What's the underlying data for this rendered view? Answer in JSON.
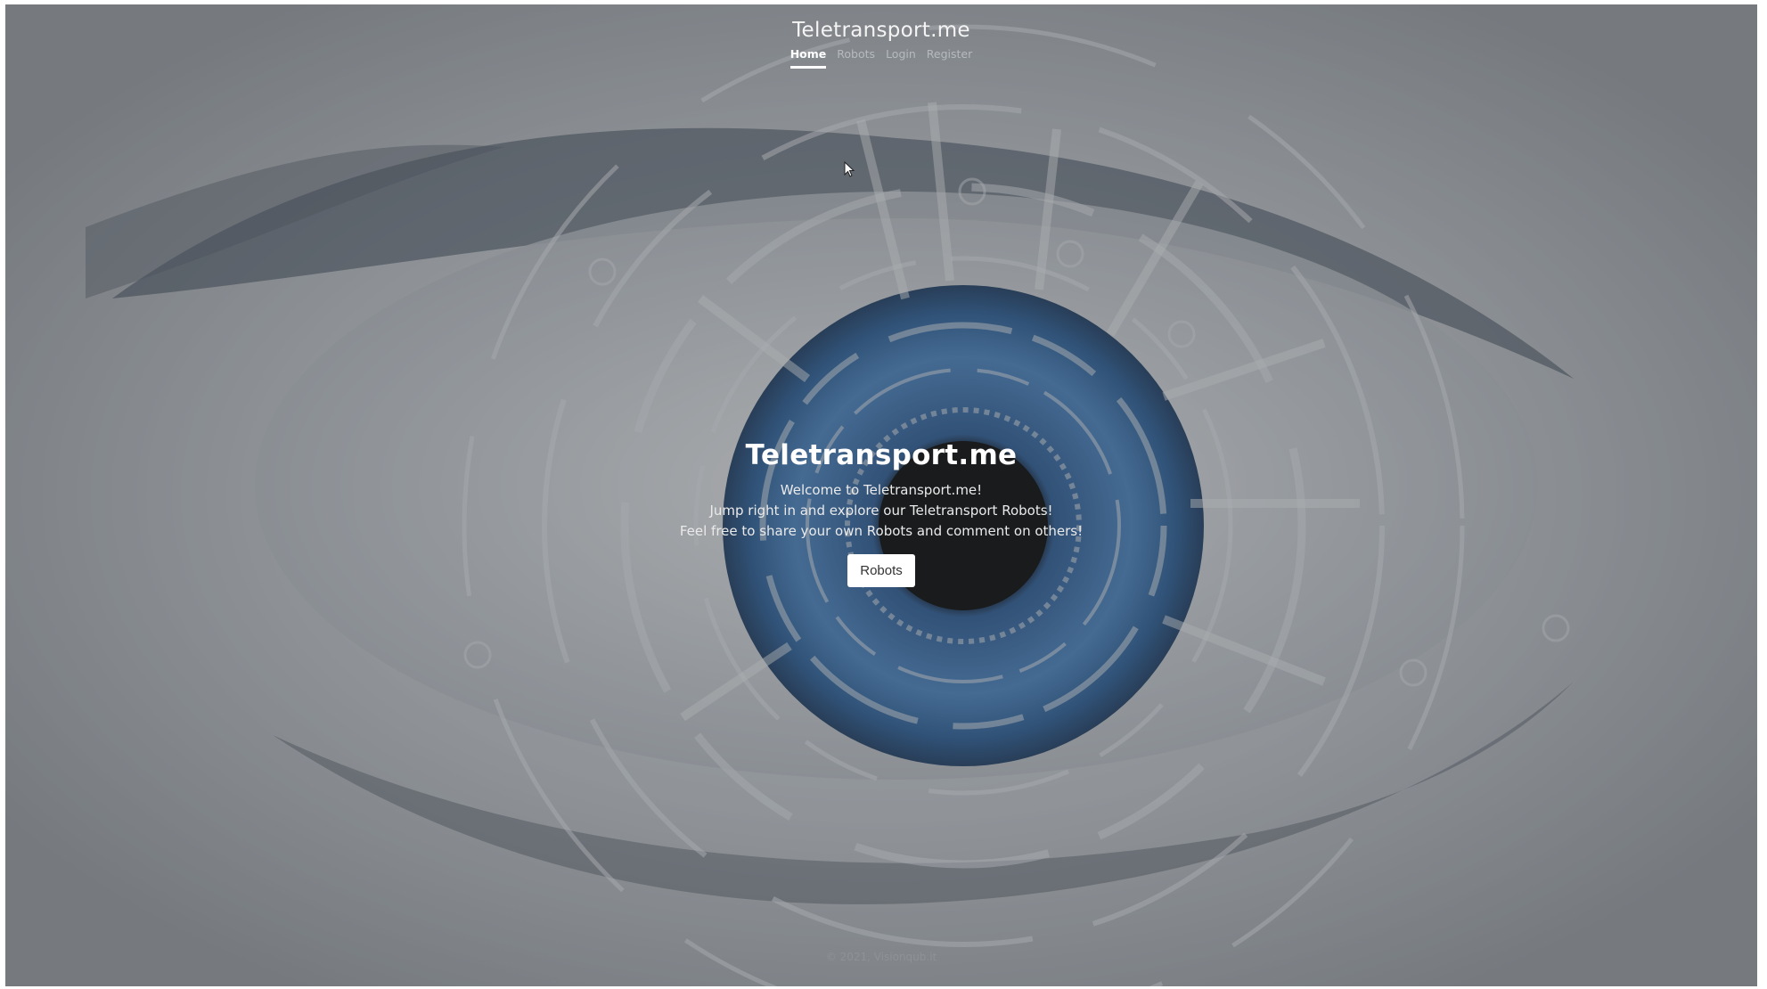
{
  "header": {
    "brand": "Teletransport.me",
    "nav": [
      {
        "label": "Home",
        "active": true
      },
      {
        "label": "Robots",
        "active": false
      },
      {
        "label": "Login",
        "active": false
      },
      {
        "label": "Register",
        "active": false
      }
    ]
  },
  "cover": {
    "title": "Teletransport.me",
    "lines": [
      "Welcome to Teletransport.me!",
      "Jump right in and explore our Teletransport Robots!",
      "Feel free to share your own Robots and comment on others!"
    ],
    "button_label": "Robots"
  },
  "footer": {
    "text": "© 2021, Visionqub.it"
  },
  "colors": {
    "iris": "#3f72b3",
    "accent": "#ffffff"
  }
}
